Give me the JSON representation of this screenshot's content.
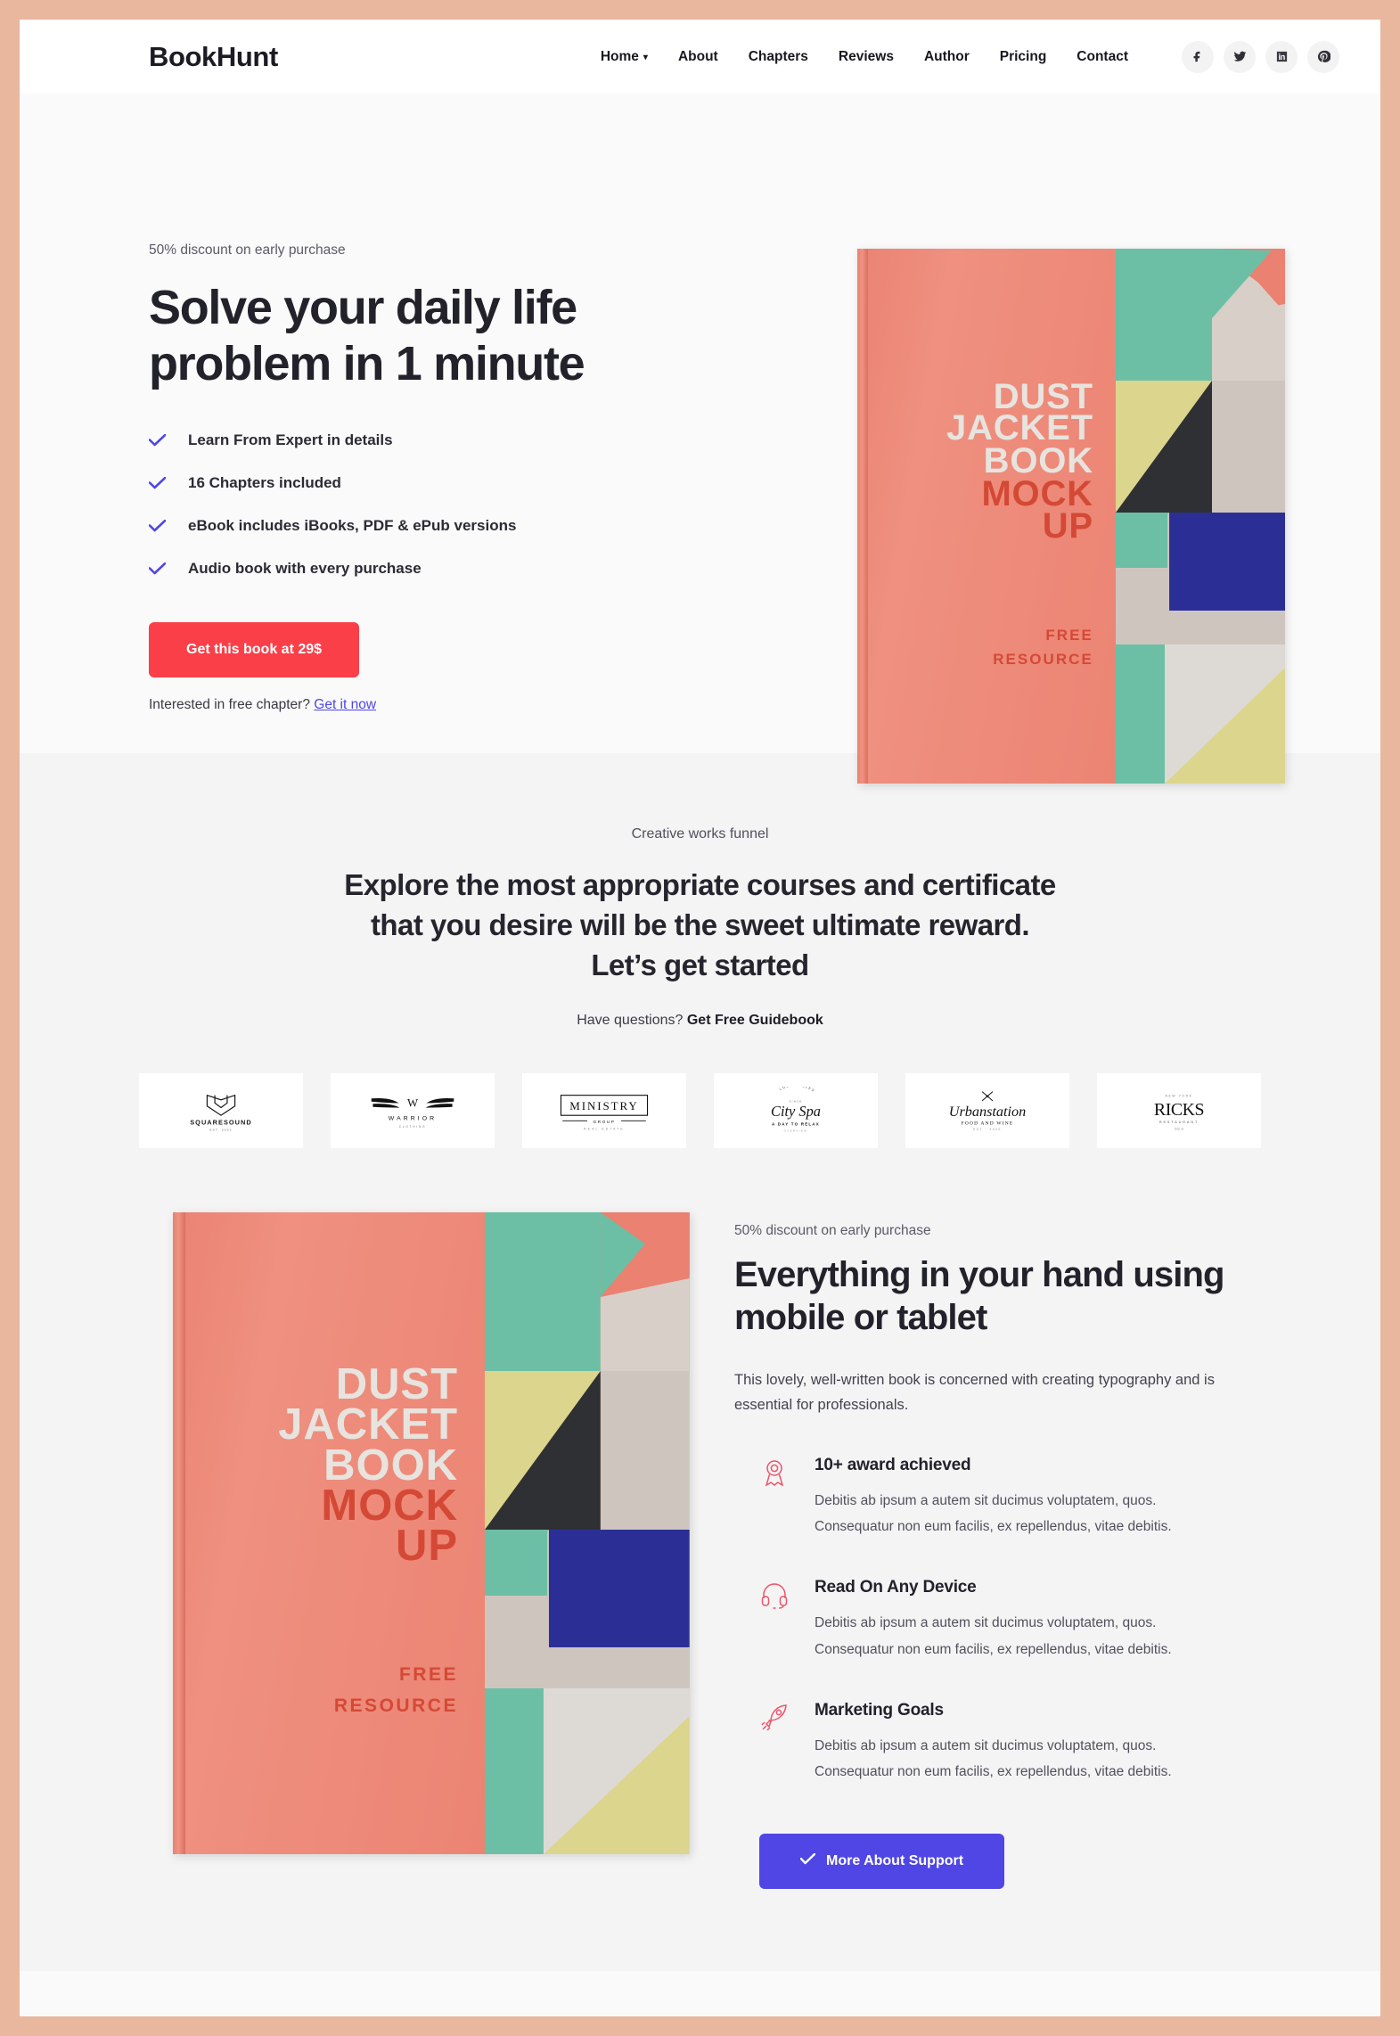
{
  "nav": {
    "brand": "BookHunt",
    "links": [
      {
        "label": "Home",
        "has_dropdown": true
      },
      {
        "label": "About",
        "has_dropdown": false
      },
      {
        "label": "Chapters",
        "has_dropdown": false
      },
      {
        "label": "Reviews",
        "has_dropdown": false
      },
      {
        "label": "Author",
        "has_dropdown": false
      },
      {
        "label": "Pricing",
        "has_dropdown": false
      },
      {
        "label": "Contact",
        "has_dropdown": false
      }
    ],
    "social": [
      {
        "name": "facebook-icon"
      },
      {
        "name": "twitter-icon"
      },
      {
        "name": "linkedin-icon"
      },
      {
        "name": "pinterest-icon"
      }
    ]
  },
  "hero": {
    "eyebrow": "50% discount on early purchase",
    "title": "Solve your daily life problem in 1 minute",
    "features": [
      "Learn From Expert in details",
      "16 Chapters included",
      "eBook includes iBooks, PDF & ePub versions",
      "Audio book with every purchase"
    ],
    "cta_label": "Get this book at 29$",
    "free_prefix": "Interested in free chapter?",
    "free_link": "Get it now"
  },
  "book_cover": {
    "line1": "DUST",
    "line2": "JACKET",
    "line3": "BOOK",
    "line4": "MOCK",
    "line5": "UP",
    "line6": "FREE",
    "line7": "RESOURCE"
  },
  "section2": {
    "eyebrow": "Creative works funnel",
    "title": "Explore the most appropriate courses and certificate that you desire will be the sweet ultimate reward. Let’s get started",
    "sub_prefix": "Have questions?",
    "sub_link": "Get Free Guidebook",
    "logos": [
      {
        "name": "squaresound-logo",
        "title": "SQUARESOUND",
        "sub": "EST. 2001"
      },
      {
        "name": "warrior-clothing-logo",
        "title": "WARRIOR",
        "sub": "CLOTHING"
      },
      {
        "name": "ministry-group-logo",
        "title": "MINISTRY",
        "sub": "GROUP",
        "sub2": "REAL ESTATE"
      },
      {
        "name": "city-spa-logo",
        "title": "City Spa",
        "top": "LOS ANGELES",
        "sub": "A DAY TO RELAX"
      },
      {
        "name": "urbanstation-logo",
        "title": "Urbanstation",
        "sub": "FOOD AND WINE",
        "sub2": "EST · 2020"
      },
      {
        "name": "ricks-restaurant-logo",
        "title": "RICKS",
        "top": "NEW YORK",
        "sub": "RESTAURANT"
      }
    ]
  },
  "section3": {
    "eyebrow": "50% discount on early purchase",
    "title": "Everything in your hand using mobile or tablet",
    "paragraph": "This lovely, well-written book is concerned with creating typography and is essential for professionals.",
    "features": [
      {
        "icon": "award-ribbon-icon",
        "title": "10+ award achieved",
        "line1": "Debitis ab ipsum a autem sit ducimus voluptatem, quos.",
        "line2": "Consequatur non eum facilis, ex repellendus, vitae debitis."
      },
      {
        "icon": "headphones-icon",
        "title": "Read On Any Device",
        "line1": "Debitis ab ipsum a autem sit ducimus voluptatem, quos.",
        "line2": "Consequatur non eum facilis, ex repellendus, vitae debitis."
      },
      {
        "icon": "rocket-icon",
        "title": "Marketing Goals",
        "line1": "Debitis ab ipsum a autem sit ducimus voluptatem, quos.",
        "line2": "Consequatur non eum facilis, ex repellendus, vitae debitis."
      }
    ],
    "cta_label": "More About Support"
  },
  "colors": {
    "page_bg": "#e9b79e",
    "accent_red": "#fa3f48",
    "accent_purple": "#4f46e5",
    "icon_pink": "#ec5569",
    "cover_coral": "#ec8473"
  }
}
